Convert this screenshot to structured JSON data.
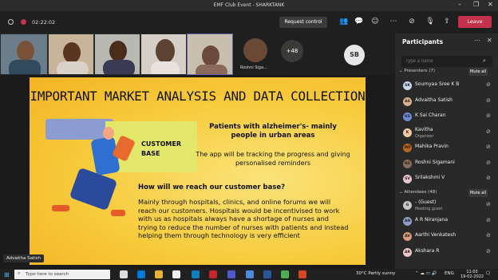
{
  "window": {
    "title": "EMF Club Event - SHARKTANK",
    "controls": [
      "–",
      "❐",
      "✕"
    ]
  },
  "toolbar": {
    "timer": "02:22:02",
    "request_control": "Request control",
    "leave": "Leave"
  },
  "video": {
    "more_count": "+48",
    "tile_name": "Roshni Siga...",
    "sb_initials": "SB"
  },
  "slide": {
    "title": "IMPORTANT MARKET ANALYSIS AND DATA COLLECTION",
    "box_label_1": "CUSTOMER",
    "box_label_2": "BASE",
    "heading1": "Patients with alzheimer's- mainly people in urban areas",
    "para1": "The app will be tracking the progress and giving personalised reminders",
    "heading2": "How will we reach our customer base?",
    "para2": "Mainly through hospitals, clinics, and online forums we will reach our customers. Hospitals would be incentivised to work with us as hospitals always have a shortage of nurses and trying to reduce the number of nurses with patients and instead helping them through technology is very efficient"
  },
  "speaker_badge": "Advaitha Satish",
  "participants": {
    "title": "Participants",
    "search_placeholder": "Type a name",
    "presenters_label": "Presenters (7)",
    "attendees_label": "Attendees (48)",
    "mute_all": "Mute all",
    "presenters": [
      {
        "initials": "SK",
        "name": "Soumyaa Sree K B",
        "sub": "",
        "color": "#c8d6f5"
      },
      {
        "initials": "AS",
        "name": "Advaitha Satish",
        "sub": "",
        "color": "#d9b38c"
      },
      {
        "initials": "KS",
        "name": "K Sai Charan",
        "sub": "",
        "color": "#6c8cd5"
      },
      {
        "initials": "K",
        "name": "Kavitha",
        "sub": "Organizer",
        "color": "#f0c9a0"
      },
      {
        "initials": "MP",
        "name": "Mahika Pravin",
        "sub": "",
        "color": "#b5651d"
      },
      {
        "initials": "RS",
        "name": "Roshni Sigamani",
        "sub": "",
        "color": "#8c6b5a"
      },
      {
        "initials": "SV",
        "name": "Srilakshmi V",
        "sub": "",
        "color": "#e7c6d8"
      }
    ],
    "attendees": [
      {
        "initials": "G",
        "name": "- (Guest)",
        "sub": "Meeting guest",
        "color": "#c8c8c8"
      },
      {
        "initials": "AN",
        "name": "A R Niranjana",
        "sub": "",
        "color": "#8fa0c8"
      },
      {
        "initials": "AV",
        "name": "Aarthi Venkatesh",
        "sub": "",
        "color": "#d99a7a"
      },
      {
        "initials": "AR",
        "name": "Akshara R",
        "sub": "",
        "color": "#f5c6cb"
      }
    ]
  },
  "taskbar": {
    "search_placeholder": "Type here to search",
    "weather": "30°C  Partly sunny",
    "lang": "ENG",
    "time": "11:03",
    "date": "19-02-2022"
  }
}
